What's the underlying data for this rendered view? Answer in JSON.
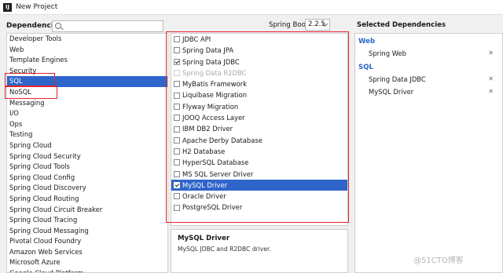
{
  "window": {
    "title": "New Project",
    "icon_glyph": "IJ"
  },
  "left": {
    "header_label": "Dependencies",
    "search_placeholder": "",
    "categories": [
      "Developer Tools",
      "Web",
      "Template Engines",
      "Security",
      "SQL",
      "NoSQL",
      "Messaging",
      "I/O",
      "Ops",
      "Testing",
      "Spring Cloud",
      "Spring Cloud Security",
      "Spring Cloud Tools",
      "Spring Cloud Config",
      "Spring Cloud Discovery",
      "Spring Cloud Routing",
      "Spring Cloud Circuit Breaker",
      "Spring Cloud Tracing",
      "Spring Cloud Messaging",
      "Pivotal Cloud Foundry",
      "Amazon Web Services",
      "Microsoft Azure",
      "Google Cloud Platform"
    ],
    "selected_category": "SQL"
  },
  "middle": {
    "spring_boot_label": "Spring Boot",
    "spring_boot_version": "2.2.5",
    "dependencies": [
      {
        "label": "JDBC API",
        "checked": false,
        "disabled": false,
        "selected": false
      },
      {
        "label": "Spring Data JPA",
        "checked": false,
        "disabled": false,
        "selected": false
      },
      {
        "label": "Spring Data JDBC",
        "checked": true,
        "disabled": false,
        "selected": false
      },
      {
        "label": "Spring Data R2DBC",
        "checked": false,
        "disabled": true,
        "selected": false
      },
      {
        "label": "MyBatis Framework",
        "checked": false,
        "disabled": false,
        "selected": false
      },
      {
        "label": "Liquibase Migration",
        "checked": false,
        "disabled": false,
        "selected": false
      },
      {
        "label": "Flyway Migration",
        "checked": false,
        "disabled": false,
        "selected": false
      },
      {
        "label": "JOOQ Access Layer",
        "checked": false,
        "disabled": false,
        "selected": false
      },
      {
        "label": "IBM DB2 Driver",
        "checked": false,
        "disabled": false,
        "selected": false
      },
      {
        "label": "Apache Derby Database",
        "checked": false,
        "disabled": false,
        "selected": false
      },
      {
        "label": "H2 Database",
        "checked": false,
        "disabled": false,
        "selected": false
      },
      {
        "label": "HyperSQL Database",
        "checked": false,
        "disabled": false,
        "selected": false
      },
      {
        "label": "MS SQL Server Driver",
        "checked": false,
        "disabled": false,
        "selected": false
      },
      {
        "label": "MySQL Driver",
        "checked": true,
        "disabled": false,
        "selected": true
      },
      {
        "label": "Oracle Driver",
        "checked": false,
        "disabled": false,
        "selected": false
      },
      {
        "label": "PostgreSQL Driver",
        "checked": false,
        "disabled": false,
        "selected": false
      }
    ],
    "description": {
      "title": "MySQL Driver",
      "text": "MySQL JDBC and R2DBC driver."
    }
  },
  "right": {
    "header_label": "Selected Dependencies",
    "groups": [
      {
        "name": "Web",
        "items": [
          "Spring Web"
        ]
      },
      {
        "name": "SQL",
        "items": [
          "Spring Data JDBC",
          "MySQL Driver"
        ]
      }
    ],
    "remove_glyph": "✕"
  },
  "watermark": "@51CTO博客",
  "colors": {
    "selection": "#2f65ca",
    "annotation": "#e0262c"
  }
}
